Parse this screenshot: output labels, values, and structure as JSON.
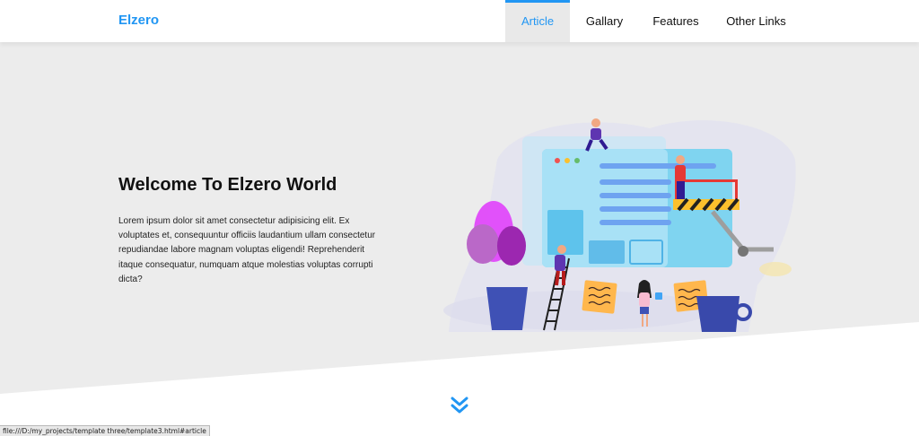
{
  "header": {
    "logo": "Elzero",
    "nav": [
      {
        "label": "Article",
        "active": true
      },
      {
        "label": "Gallary",
        "active": false
      },
      {
        "label": "Features",
        "active": false
      },
      {
        "label": "Other Links",
        "active": false
      }
    ]
  },
  "landing": {
    "title": "Welcome To Elzero World",
    "text": "Lorem ipsum dolor sit amet consectetur adipisicing elit. Ex voluptates et, consequuntur officiis laudantium ullam consectetur repudiandae labore magnam voluptas eligendi! Reprehenderit itaque consequatur, numquam atque molestias voluptas corrupti dicta?",
    "go_down_icon": "double-chevron-down-icon"
  },
  "status_bar": {
    "url": "file:///D:/my_projects/template three/template3.html#article"
  },
  "colors": {
    "accent": "#2196f3",
    "landing_bg": "#ececec",
    "text": "#111111"
  }
}
